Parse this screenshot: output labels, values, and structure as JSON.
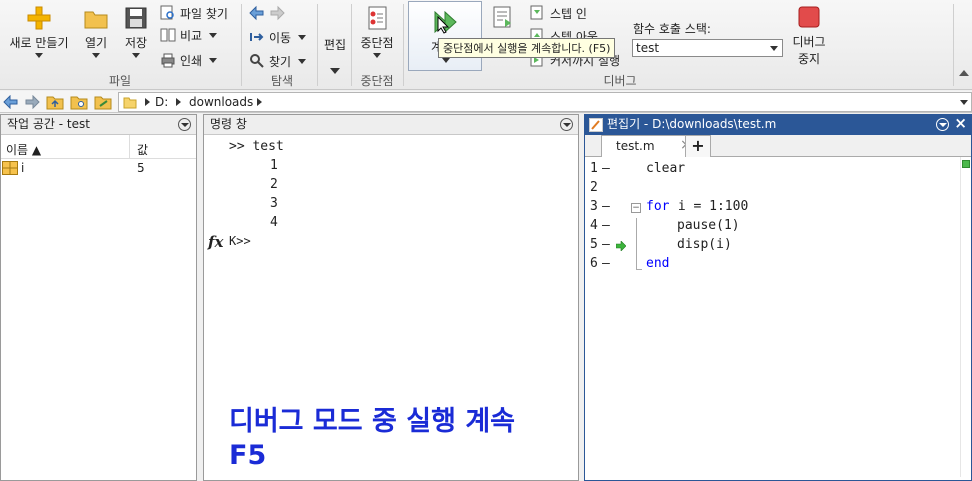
{
  "ribbon": {
    "file": {
      "group_label": "파일",
      "new_label": "새로 만들기",
      "open_label": "열기",
      "save_label": "저장",
      "find_files_label": "파일 찾기",
      "compare_label": "비교",
      "print_label": "인쇄"
    },
    "navigate": {
      "group_label": "탐색",
      "goto_label": "이동",
      "find_label": "찾기"
    },
    "edit": {
      "label": "편집"
    },
    "breakpoints": {
      "group_label": "중단점",
      "button_label": "중단점"
    },
    "debug": {
      "group_label": "디버그",
      "continue_label": "계속",
      "step_in_label": "스텝 인",
      "step_out_label": "스텝 아웃",
      "run_to_cursor_label": "커서까지 실행",
      "call_stack_label": "함수 호출 스택:",
      "call_stack_value": "test",
      "stop_label_1": "디버그",
      "stop_label_2": "중지",
      "tooltip": "중단점에서 실행을 계속합니다. (F5)"
    }
  },
  "address": {
    "drive": "D:",
    "folder": "downloads"
  },
  "workspace": {
    "title": "작업 공간 - test",
    "col_name": "이름 ▲",
    "col_value": "값",
    "rows": [
      {
        "name": "i",
        "value": "5"
      }
    ]
  },
  "command": {
    "title": "명령 창",
    "lines": [
      ">> test",
      "1",
      "2",
      "3",
      "4"
    ],
    "prompt": "K>>",
    "fx": "fx"
  },
  "editor": {
    "title": "편집기 - D:\\downloads\\test.m",
    "tab_label": "test.m",
    "lines": [
      {
        "num": "1",
        "dash": "–",
        "code": "clear"
      },
      {
        "num": "2",
        "dash": "",
        "code": ""
      },
      {
        "num": "3",
        "dash": "–",
        "kw": "for",
        "code": " i = 1:100"
      },
      {
        "num": "4",
        "dash": "–",
        "code": "pause(1)"
      },
      {
        "num": "5",
        "dash": "–",
        "code": "disp(i)"
      },
      {
        "num": "6",
        "dash": "–",
        "kw": "end",
        "code": ""
      }
    ]
  },
  "caption": {
    "line1": "디버그 모드 중 실행 계속",
    "line2": "F5",
    "color": "#1a2bd6"
  }
}
